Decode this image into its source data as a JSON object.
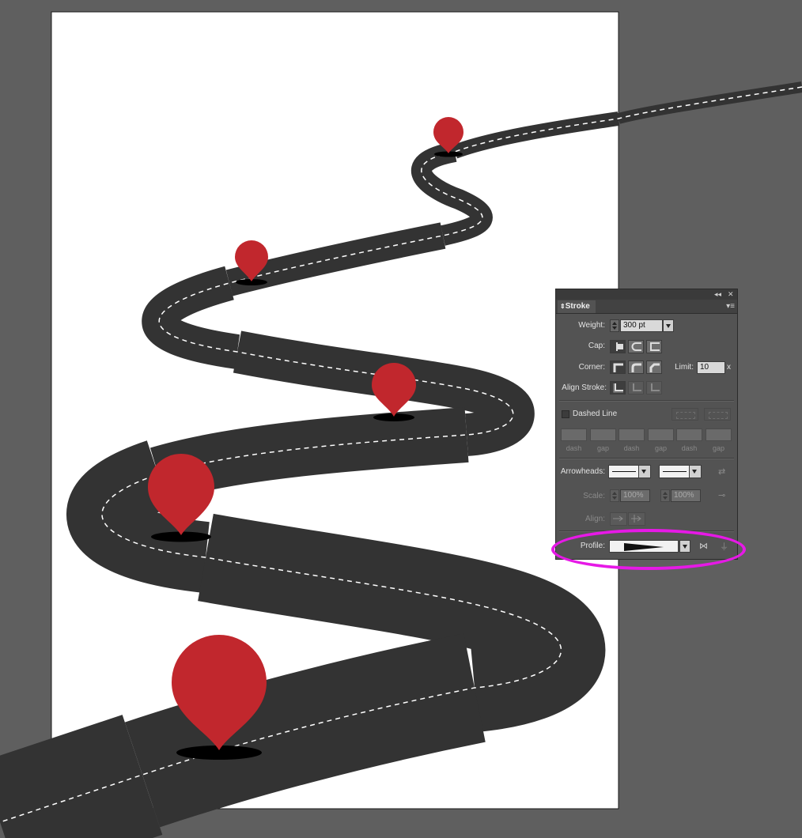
{
  "panel": {
    "tab": "Stroke",
    "collapse_icon": "double-chevron-left",
    "close_icon": "close-x",
    "menu_icon": "panel-menu",
    "weight": {
      "label": "Weight:",
      "value": "300 pt"
    },
    "cap": {
      "label": "Cap:",
      "options": [
        "butt-cap-icon",
        "round-cap-icon",
        "projecting-cap-icon"
      ],
      "selected": 0
    },
    "corner": {
      "label": "Corner:",
      "options": [
        "miter-join-icon",
        "round-join-icon",
        "bevel-join-icon"
      ],
      "selected": 0
    },
    "limit": {
      "label": "Limit:",
      "value": "10",
      "suffix": "x"
    },
    "align_stroke": {
      "label": "Align Stroke:",
      "options": [
        "align-center-icon",
        "align-inside-icon",
        "align-outside-icon"
      ],
      "selected": 0
    },
    "dashed_line": {
      "label": "Dashed Line",
      "checked": false
    },
    "dash_gap": [
      {
        "value": "",
        "label": "dash"
      },
      {
        "value": "",
        "label": "gap"
      },
      {
        "value": "",
        "label": "dash"
      },
      {
        "value": "",
        "label": "gap"
      },
      {
        "value": "",
        "label": "dash"
      },
      {
        "value": "",
        "label": "gap"
      }
    ],
    "arrowheads": {
      "label": "Arrowheads:",
      "start": "None",
      "end": "None"
    },
    "scale": {
      "label": "Scale:",
      "start": "100%",
      "end": "100%"
    },
    "align": {
      "label": "Align:"
    },
    "profile": {
      "label": "Profile:",
      "value": "width-profile-taper",
      "flip_icon": "flip-along-icon",
      "reset_icon": "flip-across-icon"
    },
    "highlight_color": "#e619e6"
  },
  "artwork": {
    "background": "#5f5f5f",
    "artboard_color": "#ffffff",
    "road_color": "#333333",
    "lane_color": "#ffffff",
    "pin_color": "#c1272d",
    "shadow_color": "#000000",
    "pin_count": 5
  }
}
